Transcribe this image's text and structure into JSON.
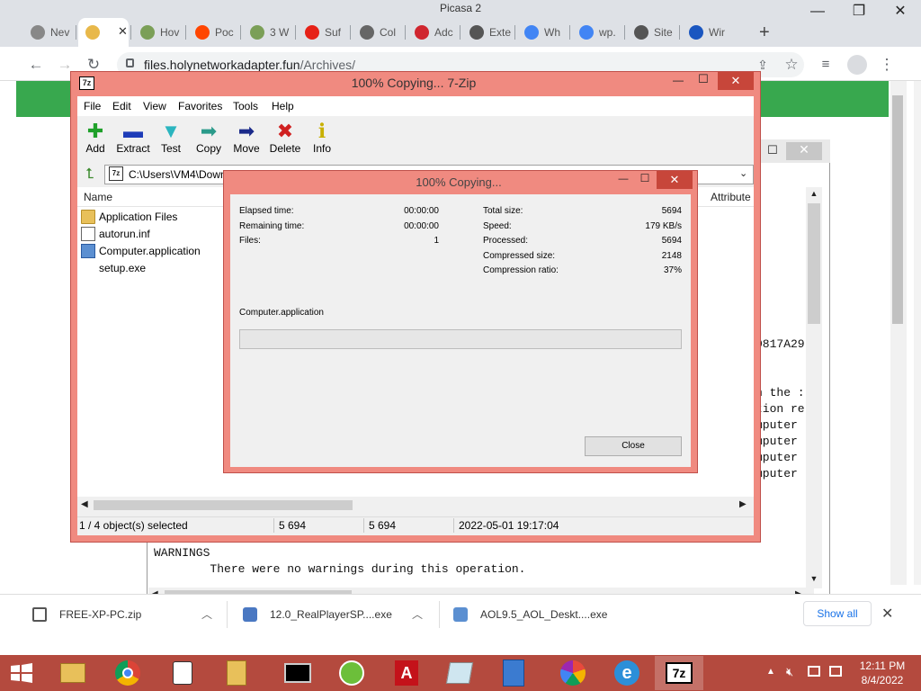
{
  "chrome": {
    "window_title": "Picasa 2",
    "tabs": [
      {
        "label": "Nev",
        "icon": "chrome-icon"
      },
      {
        "label": "",
        "icon": "folder-icon"
      },
      {
        "label": "Hov",
        "icon": "pod-icon"
      },
      {
        "label": "Poc",
        "icon": "reddit-icon"
      },
      {
        "label": "3 W",
        "icon": "pod-icon"
      },
      {
        "label": "Suf",
        "icon": "youtube-icon"
      },
      {
        "label": "Col",
        "icon": "page-icon"
      },
      {
        "label": "Adc",
        "icon": "adobe-icon"
      },
      {
        "label": "Exte",
        "icon": "puzzle-icon"
      },
      {
        "label": "Wh",
        "icon": "google-icon"
      },
      {
        "label": "wp.",
        "icon": "google-icon"
      },
      {
        "label": "Site",
        "icon": "globe-icon"
      },
      {
        "label": "Wir",
        "icon": "sail-icon"
      }
    ],
    "new_tab": "+",
    "url_host": "files.holynetworkadapter.fun",
    "url_path": "/Archives/"
  },
  "log_window": {
    "right_fragments": [
      "0817A29",
      "n the :",
      "tion re",
      "mputer",
      "mputer",
      "mputer",
      "mputer"
    ],
    "warnings_header": "WARNINGS",
    "warnings_text": "        There were no warnings during this operation."
  },
  "downloads": {
    "items": [
      "FREE-XP-PC.zip",
      "12.0_RealPlayerSP....exe",
      "AOL9.5_AOL_Deskt....exe"
    ],
    "show_all": "Show all",
    "close": "✕"
  },
  "zip": {
    "title": "100% Copying... 7-Zip",
    "app_icon": "7z",
    "menu": [
      "File",
      "Edit",
      "View",
      "Favorites",
      "Tools",
      "Help"
    ],
    "toolbar": [
      {
        "label": "Add",
        "icon": "add-icon"
      },
      {
        "label": "Extract",
        "icon": "extract-icon"
      },
      {
        "label": "Test",
        "icon": "test-icon"
      },
      {
        "label": "Copy",
        "icon": "copy-icon"
      },
      {
        "label": "Move",
        "icon": "move-icon"
      },
      {
        "label": "Delete",
        "icon": "delete-icon"
      },
      {
        "label": "Info",
        "icon": "info-icon"
      }
    ],
    "path": "C:\\Users\\VM4\\Down",
    "columns": {
      "name": "Name",
      "attributes": "Attribute"
    },
    "files": [
      {
        "name": "Application Files",
        "icon": "folder-icon"
      },
      {
        "name": "autorun.inf",
        "icon": "settings-file-icon"
      },
      {
        "name": "Computer.application",
        "icon": "application-icon"
      },
      {
        "name": "setup.exe",
        "icon": "exe-icon"
      }
    ],
    "status": {
      "selected": "1 / 4 object(s) selected",
      "size": "5 694",
      "packed": "5 694",
      "modified": "2022-05-01 19:17:04"
    }
  },
  "progress": {
    "title": "100% Copying...",
    "left": [
      {
        "label": "Elapsed time:",
        "value": "00:00:00"
      },
      {
        "label": "Remaining time:",
        "value": "00:00:00"
      },
      {
        "label": "Files:",
        "value": "1"
      }
    ],
    "right": [
      {
        "label": "Total size:",
        "value": "5694"
      },
      {
        "label": "Speed:",
        "value": "179 KB/s"
      },
      {
        "label": "Processed:",
        "value": "5694"
      },
      {
        "label": "Compressed size:",
        "value": "2148"
      },
      {
        "label": "Compression ratio:",
        "value": "37%"
      }
    ],
    "current_file": "Computer.application",
    "progress_fraction": 0,
    "close_label": "Close"
  },
  "taskbar": {
    "apps": [
      "file-explorer-icon",
      "chrome-icon",
      "java-icon",
      "folder-icon",
      "cmd-icon",
      "green-app-icon",
      "adobe-reader-icon",
      "pad-icon",
      "installer-icon",
      "picasa-icon",
      "ie-icon",
      "7zip-icon"
    ],
    "time": "12:11 PM",
    "date": "8/4/2022"
  },
  "colors": {
    "frame": "#f08a80",
    "taskbar": "#b44a3e",
    "progress": "#06b025",
    "chrome_green": "#38a84e"
  }
}
